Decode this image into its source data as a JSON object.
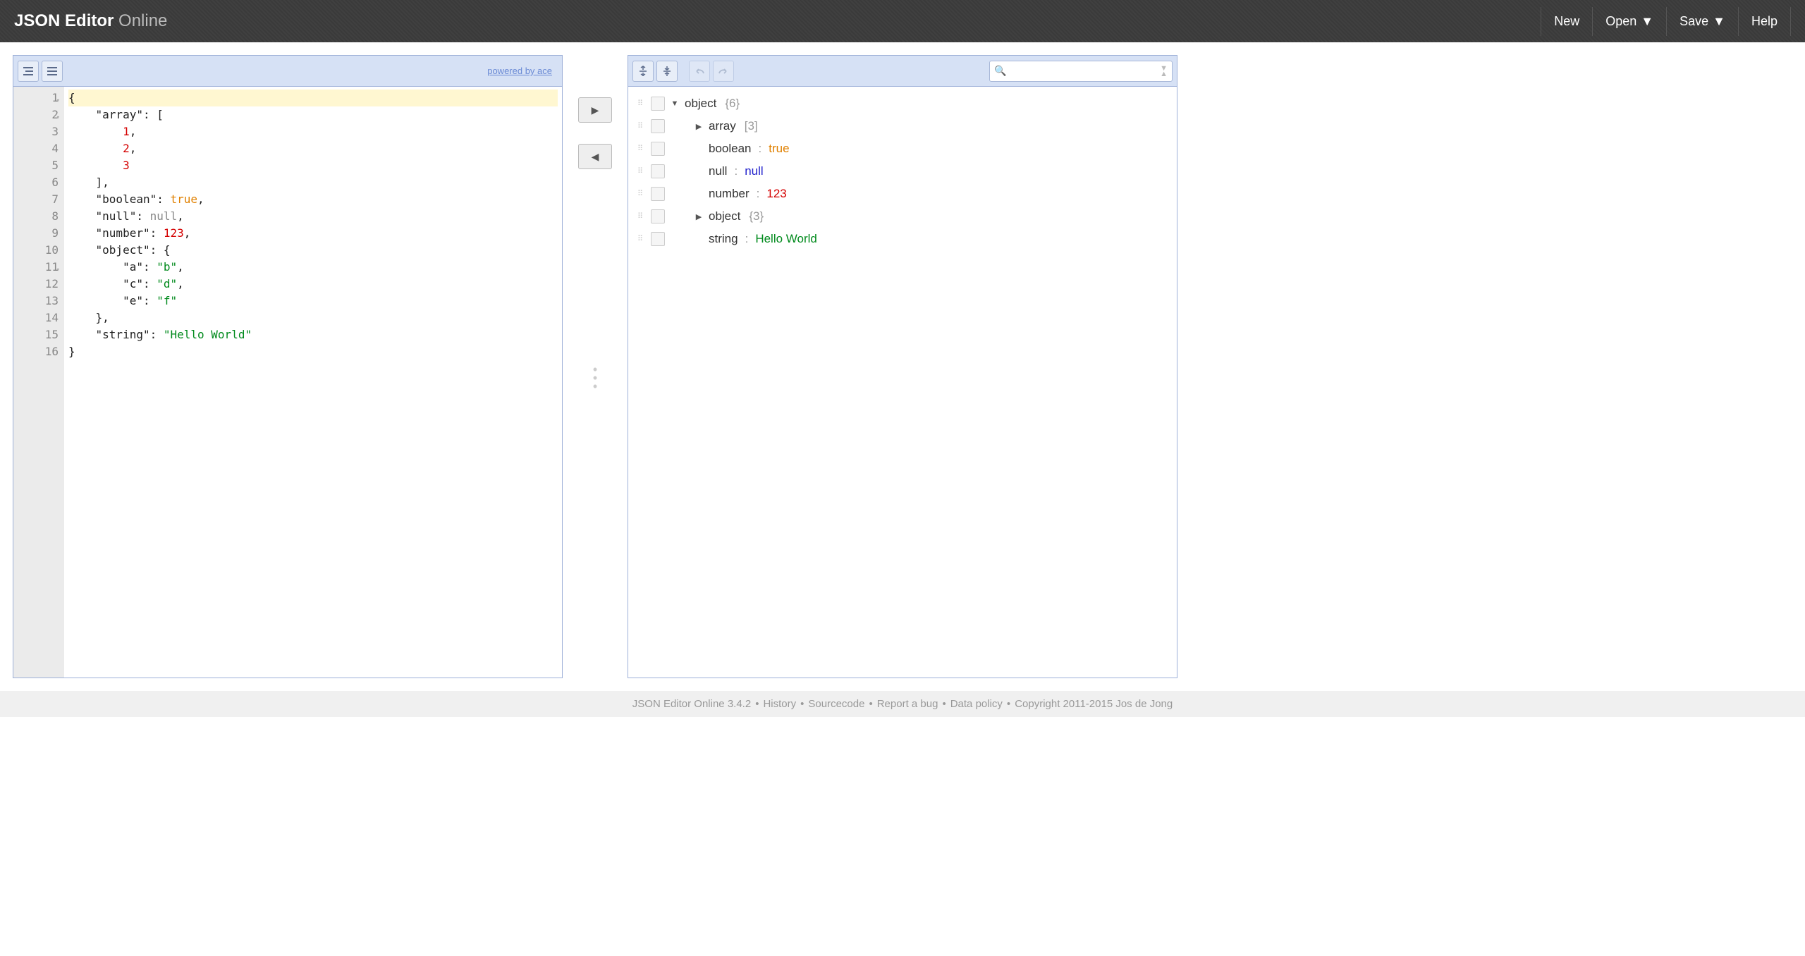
{
  "header": {
    "title_bold": "JSON Editor",
    "title_light": " Online",
    "menu": {
      "new": "New",
      "open": "Open",
      "save": "Save",
      "help": "Help"
    }
  },
  "left_panel": {
    "powered_by": "powered by ace",
    "lines": [
      {
        "n": "1",
        "fold": true,
        "active": true,
        "tokens": [
          [
            "punc",
            "{"
          ]
        ]
      },
      {
        "n": "2",
        "fold": true,
        "tokens": [
          [
            "indent",
            "    "
          ],
          [
            "key",
            "\"array\""
          ],
          [
            "punc",
            ": ["
          ]
        ]
      },
      {
        "n": "3",
        "tokens": [
          [
            "indent",
            "        "
          ],
          [
            "num",
            "1"
          ],
          [
            "punc",
            ","
          ]
        ]
      },
      {
        "n": "4",
        "tokens": [
          [
            "indent",
            "        "
          ],
          [
            "num",
            "2"
          ],
          [
            "punc",
            ","
          ]
        ]
      },
      {
        "n": "5",
        "tokens": [
          [
            "indent",
            "        "
          ],
          [
            "num",
            "3"
          ]
        ]
      },
      {
        "n": "6",
        "tokens": [
          [
            "indent",
            "    "
          ],
          [
            "punc",
            "],"
          ]
        ]
      },
      {
        "n": "7",
        "tokens": [
          [
            "indent",
            "    "
          ],
          [
            "key",
            "\"boolean\""
          ],
          [
            "punc",
            ": "
          ],
          [
            "bool",
            "true"
          ],
          [
            "punc",
            ","
          ]
        ]
      },
      {
        "n": "8",
        "tokens": [
          [
            "indent",
            "    "
          ],
          [
            "key",
            "\"null\""
          ],
          [
            "punc",
            ": "
          ],
          [
            "null",
            "null"
          ],
          [
            "punc",
            ","
          ]
        ]
      },
      {
        "n": "9",
        "tokens": [
          [
            "indent",
            "    "
          ],
          [
            "key",
            "\"number\""
          ],
          [
            "punc",
            ": "
          ],
          [
            "num",
            "123"
          ],
          [
            "punc",
            ","
          ]
        ]
      },
      {
        "n": "10",
        "tokens": [
          [
            "indent",
            "    "
          ],
          [
            "key",
            "\"object\""
          ],
          [
            "punc",
            ": {"
          ]
        ]
      },
      {
        "n": "11",
        "fold": true,
        "tokens": [
          [
            "indent",
            "        "
          ],
          [
            "key",
            "\"a\""
          ],
          [
            "punc",
            ": "
          ],
          [
            "str",
            "\"b\""
          ],
          [
            "punc",
            ","
          ]
        ]
      },
      {
        "n": "12",
        "tokens": [
          [
            "indent",
            "        "
          ],
          [
            "key",
            "\"c\""
          ],
          [
            "punc",
            ": "
          ],
          [
            "str",
            "\"d\""
          ],
          [
            "punc",
            ","
          ]
        ]
      },
      {
        "n": "13",
        "tokens": [
          [
            "indent",
            "        "
          ],
          [
            "key",
            "\"e\""
          ],
          [
            "punc",
            ": "
          ],
          [
            "str",
            "\"f\""
          ]
        ]
      },
      {
        "n": "14",
        "tokens": [
          [
            "indent",
            "    "
          ],
          [
            "punc",
            "},"
          ]
        ]
      },
      {
        "n": "15",
        "tokens": [
          [
            "indent",
            "    "
          ],
          [
            "key",
            "\"string\""
          ],
          [
            "punc",
            ": "
          ],
          [
            "str",
            "\"Hello World\""
          ]
        ]
      },
      {
        "n": "16",
        "tokens": [
          [
            "punc",
            "}"
          ]
        ]
      }
    ]
  },
  "right_panel": {
    "search_placeholder": "",
    "tree": [
      {
        "indent": 0,
        "caret": "down",
        "key": "object",
        "meta": "{6}"
      },
      {
        "indent": 1,
        "caret": "right",
        "key": "array",
        "meta": "[3]"
      },
      {
        "indent": 1,
        "key": "boolean",
        "val": "true",
        "vtype": "bool"
      },
      {
        "indent": 1,
        "key": "null",
        "val": "null",
        "vtype": "null"
      },
      {
        "indent": 1,
        "key": "number",
        "val": "123",
        "vtype": "num"
      },
      {
        "indent": 1,
        "caret": "right",
        "key": "object",
        "meta": "{3}"
      },
      {
        "indent": 1,
        "key": "string",
        "val": "Hello World",
        "vtype": "str"
      }
    ]
  },
  "footer": {
    "parts": [
      "JSON Editor Online 3.4.2",
      "History",
      "Sourcecode",
      "Report a bug",
      "Data policy",
      "Copyright 2011-2015 Jos de Jong"
    ]
  }
}
